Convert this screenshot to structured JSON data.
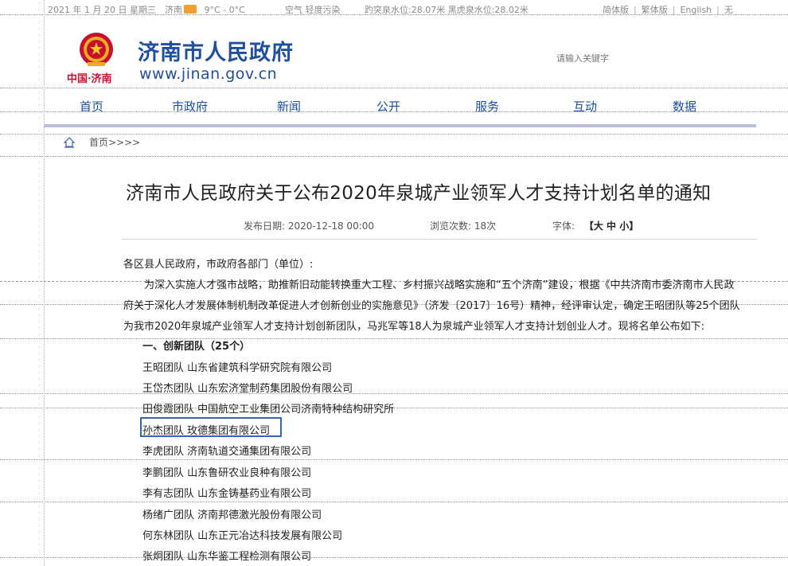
{
  "topbar": {
    "date": "2021 年 1 月 20 日 星期三",
    "city": "济南",
    "temp": "9°C - 0°C",
    "air": "空气 轻度污染",
    "water": "趵突泉水位:28.07米  黑虎泉水位:28.02米",
    "lang": [
      "简体版",
      "繁体版",
      "English",
      "无"
    ]
  },
  "header": {
    "title": "济南市人民政府",
    "url": "www.jinan.gov.cn",
    "logo_text": "中国·济南",
    "search_placeholder": "请输入关键字"
  },
  "nav": [
    "首页",
    "市政府",
    "新闻",
    "公开",
    "服务",
    "互动",
    "数据"
  ],
  "breadcrumb": "首页>>>>",
  "article": {
    "title": "济南市人民政府关于公布2020年泉城产业领军人才支持计划名单的通知",
    "date_label": "发布日期:",
    "date": "2020-12-18 00:00",
    "views_label": "浏览次数:",
    "views": "18次",
    "font_label": "字体:",
    "font_opts": "【大 中 小】",
    "salutation": "各区县人民政府，市政府各部门（单位）:",
    "para1": "为深入实施人才强市战略，助推新旧动能转换重大工程、乡村振兴战略实施和“五个济南”建设，根据《中共济南市委济南市人民政",
    "para2": "府关于深化人才发展体制机制改革促进人才创新创业的实施意见》（济发〔2017〕16号）精神，经评审认定，确定王昭团队等25个团队",
    "para3": "为我市2020年泉城产业领军人才支持计划创新团队，马兆军等18人为泉城产业领军人才支持计划创业人才。现将名单公布如下:",
    "section1": "一、创新团队（25个）",
    "teams": [
      "王昭团队 山东省建筑科学研究院有限公司",
      "王岱杰团队 山东宏济堂制药集团股份有限公司",
      "田俊霞团队 中国航空工业集团公司济南特种结构研究所",
      "孙杰团队 玫德集团有限公司",
      "李虎团队 济南轨道交通集团有限公司",
      "李鹏团队 山东鲁研农业良种有限公司",
      "李有志团队 山东金铸基药业有限公司",
      "杨绪广团队 济南邦德激光股份有限公司",
      "何东林团队 山东正元冶达科技发展有限公司",
      "张炯团队 山东华鉴工程检测有限公司"
    ]
  },
  "colors": {
    "brand": "#1f4f9e",
    "highlight": "#3a62b0"
  }
}
